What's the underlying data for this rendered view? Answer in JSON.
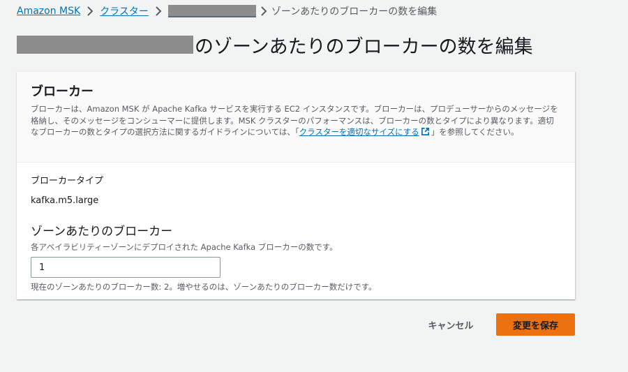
{
  "breadcrumb": {
    "items": [
      {
        "label": "Amazon MSK"
      },
      {
        "label": "クラスター"
      }
    ],
    "current": "ゾーンあたりのブローカーの数を編集"
  },
  "page": {
    "title_suffix": "のゾーンあたりのブローカーの数を編集"
  },
  "panel": {
    "title": "ブローカー",
    "description_before_link": "ブローカーは、Amazon MSK が Apache Kafka サービスを実行する EC2 インスタンスです。ブローカーは、プロデューサーからのメッセージを格納し、そのメッセージをコンシューマーに提供します。MSK クラスターのパフォーマンスは、ブローカーの数とタイプにより異なります。適切なブローカーの数とタイプの選択方法に関するガイドラインについては、「",
    "link_label": "クラスターを適切なサイズにする",
    "description_after_link": "」を参照してください。",
    "broker_type_label": "ブローカータイプ",
    "broker_type_value": "kafka.m5.large",
    "brokers_per_zone_title": "ゾーンあたりのブローカー",
    "brokers_per_zone_desc": "各アベイラビリティーゾーンにデプロイされた Apache Kafka ブローカーの数です。",
    "brokers_per_zone_value": "1",
    "hint": "現在のゾーンあたりのブローカー数: 2。増やせるのは、ゾーンあたりのブローカー数だけです。"
  },
  "actions": {
    "cancel_label": "キャンセル",
    "save_label": "変更を保存"
  },
  "colors": {
    "link": "#0073bb",
    "primary_button": "#ec7211",
    "background": "#f2f3f3"
  },
  "icons": [
    "chevron-right-icon",
    "external-link-icon"
  ]
}
